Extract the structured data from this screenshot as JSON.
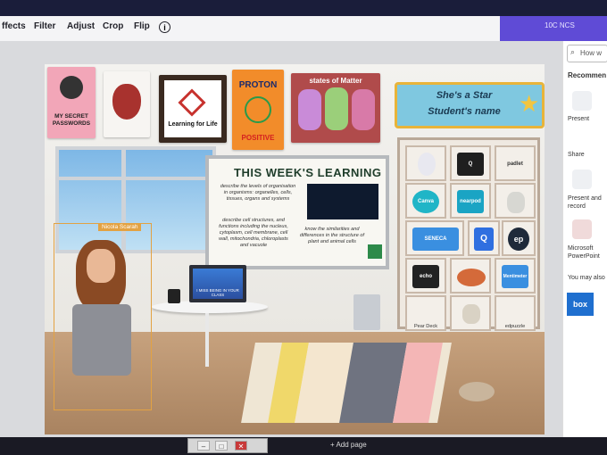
{
  "toolbar": {
    "effects_label": "ffects",
    "filter_label": "Filter",
    "adjust_label": "Adjust",
    "crop_label": "Crop",
    "flip_label": "Flip",
    "info_label": "i"
  },
  "canva_header": {
    "share_text": "10C NCS"
  },
  "classroom": {
    "posters": {
      "secret_passwords": "MY SECRET PASSWORDS",
      "learning_for_life": "Learning for Life",
      "proton_title": "PROTON",
      "proton_subtitle": "POSITIVE",
      "states_of_matter": "states of Matter"
    },
    "star_banner": {
      "line1": "She's a Star",
      "line2": "Student's name"
    },
    "board": {
      "title": "THIS WEEK'S LEARNING",
      "point1": "describe the levels of organisation in organisms: organelles, cells, tissues, organs and systems",
      "point2": "describe cell structures, and functions including the nucleus, cytoplasm, cell membrane, cell wall, mitochondria, chloroplasts and vacuole",
      "point3": "know the similarities and differences in the structure of plant and animal cells"
    },
    "laptop_text": "I MISS BEING IN YOUR CLASS",
    "bitmoji_name": "Nicola Scarah",
    "shelf_tiles": [
      {
        "label": "Q",
        "color": "#1f1f1f"
      },
      {
        "label": "padlet",
        "color": "#f3efe9"
      },
      {
        "label": "Canva",
        "color": "#20b5c7"
      },
      {
        "label": "nearpod",
        "color": "#1aa4c4"
      },
      {
        "label": "SENECA",
        "color": "#3a8fe0"
      },
      {
        "label": "Q",
        "color": "#2f6fe0"
      },
      {
        "label": "ep",
        "color": "#1f2a3a"
      },
      {
        "label": "echo",
        "color": "#222222"
      },
      {
        "label": "Mentimeter",
        "color": "#3a8fe0"
      },
      {
        "label": "Pear Deck",
        "color": "#f3efe9"
      },
      {
        "label": "edpuzzle",
        "color": "#f3efe9"
      }
    ]
  },
  "side_panel": {
    "search_placeholder": "How w",
    "recommended_label": "Recommen",
    "present_label": "Present",
    "share_label": "Share",
    "present_record_label": "Present and record",
    "powerpoint_label": "Microsoft PowerPoint",
    "also_label": "You may also",
    "box_label": "box"
  },
  "footer": {
    "add_page_label": "+ Add page"
  }
}
